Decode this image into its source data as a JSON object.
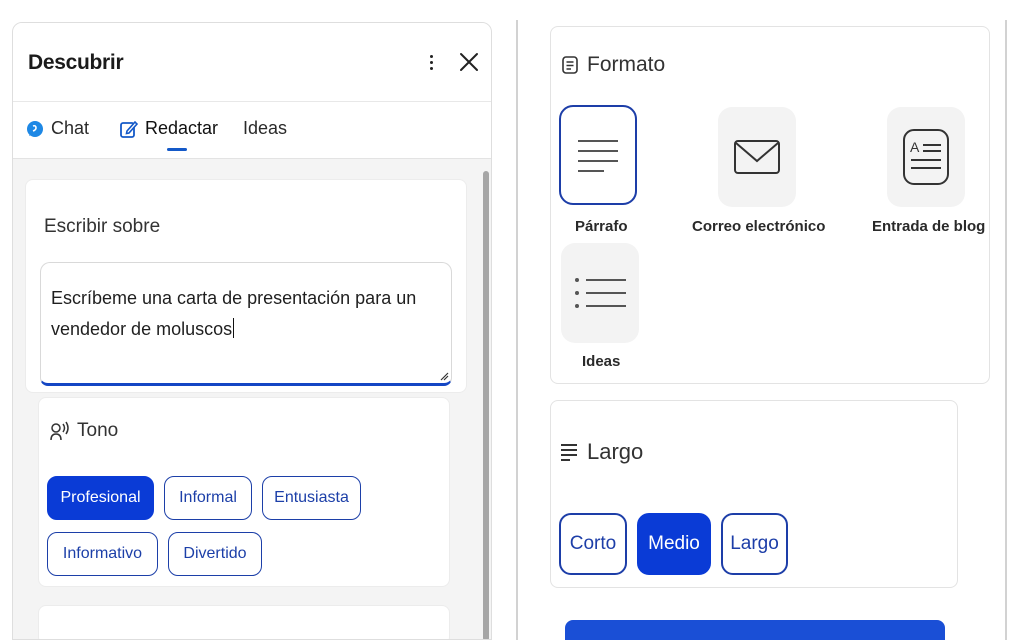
{
  "panel": {
    "title": "Descubrir",
    "tabs": [
      {
        "label": "Chat"
      },
      {
        "label": "Redactar"
      },
      {
        "label": "Ideas"
      }
    ]
  },
  "write": {
    "label": "Escribir sobre",
    "text_line1": "Escríbeme una carta de presentación para un",
    "text_line2": "vendedor de moluscos"
  },
  "tone": {
    "label": "Tono",
    "options": [
      "Profesional",
      "Informal",
      "Entusiasta",
      "Informativo",
      "Divertido"
    ],
    "selected": "Profesional"
  },
  "format": {
    "label": "Formato",
    "options": [
      "Párrafo",
      "Correo electrónico",
      "Entrada de blog",
      "Ideas"
    ],
    "selected": "Párrafo"
  },
  "length": {
    "label": "Largo",
    "options": [
      "Corto",
      "Medio",
      "Largo"
    ],
    "selected": "Medio"
  },
  "colors": {
    "accent": "#0a3bd6",
    "chip_border": "#1c3fa8"
  }
}
